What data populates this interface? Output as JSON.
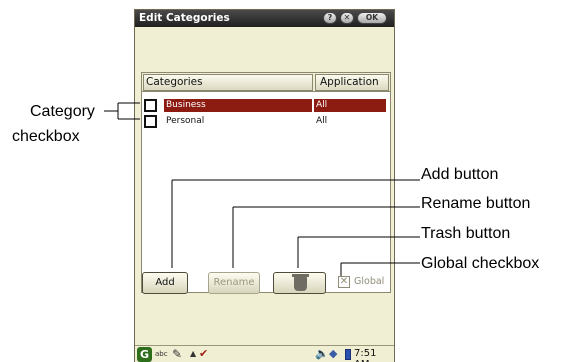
{
  "window": {
    "title": "Edit Categories",
    "help_btn": "?",
    "close_btn": "✕",
    "ok_btn": "OK"
  },
  "list": {
    "headers": [
      "Categories",
      "Application"
    ],
    "rows": [
      {
        "name": "Business",
        "app": "All",
        "selected": true
      },
      {
        "name": "Personal",
        "app": "All",
        "selected": false
      }
    ]
  },
  "buttons": {
    "add": "Add",
    "rename": "Rename"
  },
  "global": {
    "label": "Global",
    "mark": "✕"
  },
  "statusbar": {
    "logo": "G",
    "abc": "abc",
    "time": "7:51 AM"
  },
  "annotations": {
    "category_checkbox_line1": "Category",
    "category_checkbox_line2": "checkbox",
    "add_button": "Add button",
    "rename_button": "Rename button",
    "trash_button": "Trash button",
    "global_checkbox": "Global checkbox"
  },
  "colors": {
    "background": "#f1efd3",
    "selection": "#8c1c12",
    "titlebar": "#2a2a2a"
  }
}
